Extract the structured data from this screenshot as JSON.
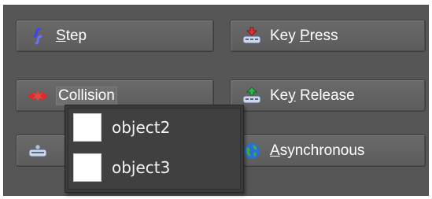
{
  "events": {
    "step": {
      "label_mn": "S",
      "label_rest": "tep",
      "icon": "step-icon"
    },
    "collision": {
      "label": "Collision",
      "icon": "collision-icon"
    },
    "other": {
      "label": "",
      "icon": "other-event-icon"
    },
    "key_press": {
      "label_pre": "Key ",
      "label_mn": "P",
      "label_rest": "ress",
      "icon": "key-press-icon"
    },
    "key_release": {
      "label_pre": "Ke",
      "label_mn": "y",
      "label_rest": " Release",
      "icon": "key-release-icon"
    },
    "asynchronous": {
      "label_mn": "A",
      "label_rest": "synchronous",
      "icon": "globe-icon"
    }
  },
  "collision_menu": {
    "items": [
      {
        "name": "object2"
      },
      {
        "name": "object3"
      }
    ]
  },
  "colors": {
    "panel": "#565656",
    "button": "#636363",
    "popup": "#3a3a3a",
    "text": "#ffffff"
  }
}
